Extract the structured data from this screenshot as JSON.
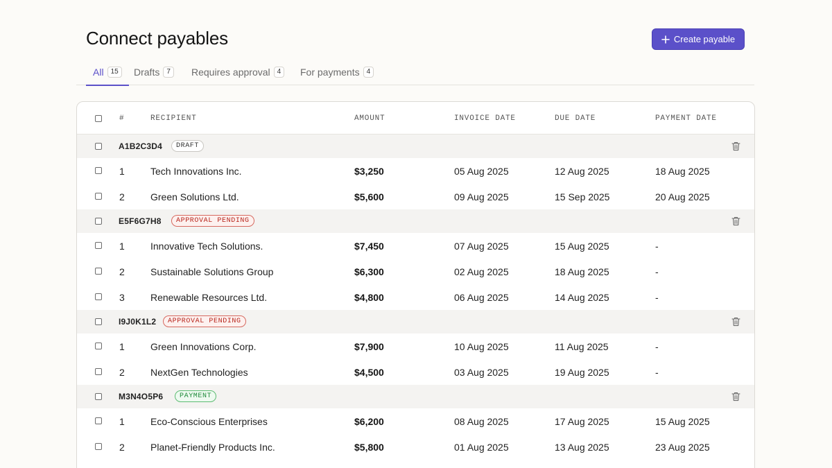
{
  "page": {
    "title": "Connect payables"
  },
  "header": {
    "create_label": "Create payable"
  },
  "tabs": [
    {
      "label": "All",
      "count": "15"
    },
    {
      "label": "Drafts",
      "count": "7"
    },
    {
      "label": "Requires approval",
      "count": "4"
    },
    {
      "label": "For payments",
      "count": "4"
    }
  ],
  "table": {
    "columns": [
      "#",
      "RECIPIENT",
      "AMOUNT",
      "INVOICE DATE",
      "DUE DATE",
      "PAYMENT DATE"
    ],
    "groups": [
      {
        "id": "A1B2C3D4",
        "status": "DRAFT",
        "status_type": "draft",
        "rows": [
          {
            "num": "1",
            "recipient": "Tech Innovations Inc.",
            "amount": "$3,250",
            "invoice_date": "05 Aug 2025",
            "due_date": "12 Aug 2025",
            "payment_date": "18 Aug 2025"
          },
          {
            "num": "2",
            "recipient": "Green Solutions Ltd.",
            "amount": "$5,600",
            "invoice_date": "09 Aug 2025",
            "due_date": "15 Sep 2025",
            "payment_date": "20 Aug 2025"
          }
        ]
      },
      {
        "id": "E5F6G7H8",
        "status": "APPROVAL PENDING",
        "status_type": "pending",
        "rows": [
          {
            "num": "1",
            "recipient": "Innovative Tech Solutions.",
            "amount": "$7,450",
            "invoice_date": "07 Aug 2025",
            "due_date": "15 Aug 2025",
            "payment_date": "-"
          },
          {
            "num": "2",
            "recipient": "Sustainable Solutions Group",
            "amount": "$6,300",
            "invoice_date": "02 Aug 2025",
            "due_date": "18 Aug 2025",
            "payment_date": "-"
          },
          {
            "num": "3",
            "recipient": "Renewable Resources Ltd.",
            "amount": "$4,800",
            "invoice_date": "06 Aug 2025",
            "due_date": "14 Aug 2025",
            "payment_date": "-"
          }
        ]
      },
      {
        "id": "I9J0K1L2",
        "status": "APPROVAL PENDING",
        "status_type": "pending",
        "rows": [
          {
            "num": "1",
            "recipient": "Green Innovations Corp.",
            "amount": "$7,900",
            "invoice_date": "10 Aug 2025",
            "due_date": "11 Aug 2025",
            "payment_date": "-"
          },
          {
            "num": "2",
            "recipient": "NextGen Technologies",
            "amount": "$4,500",
            "invoice_date": "03 Aug 2025",
            "due_date": "19 Aug 2025",
            "payment_date": "-"
          }
        ]
      },
      {
        "id": "M3N4O5P6",
        "status": "PAYMENT",
        "status_type": "payment",
        "rows": [
          {
            "num": "1",
            "recipient": "Eco-Conscious Enterprises",
            "amount": "$6,200",
            "invoice_date": "08 Aug 2025",
            "due_date": "17 Aug 2025",
            "payment_date": "15 Aug 2025"
          },
          {
            "num": "2",
            "recipient": "Planet-Friendly Products Inc.",
            "amount": "$5,800",
            "invoice_date": "01 Aug 2025",
            "due_date": "13 Aug 2025",
            "payment_date": "23 Aug 2025"
          }
        ]
      }
    ]
  }
}
